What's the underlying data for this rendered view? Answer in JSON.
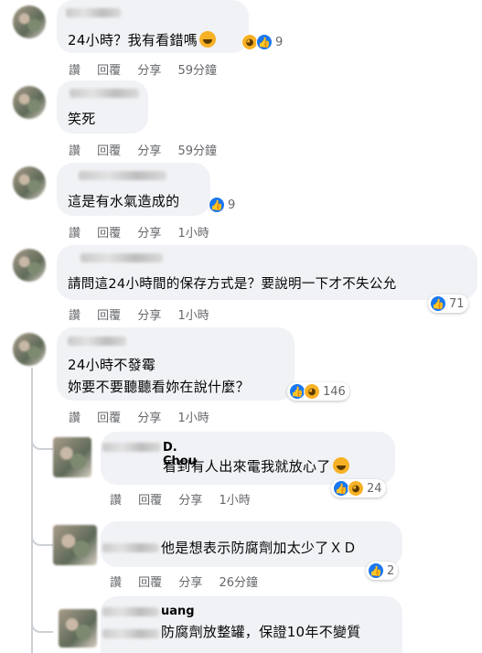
{
  "actions": {
    "like": "讚",
    "reply": "回覆",
    "share": "分享"
  },
  "colors": {
    "bubble": "#f0f2f5",
    "meta": "#65676b",
    "like": "#1877f2",
    "haha": "#f7b125"
  },
  "comments": [
    {
      "text": "24小時？我有看錯嗎",
      "time": "59分鐘",
      "reaction_count": "9",
      "reactions": [
        "haha-icon",
        "like-icon"
      ],
      "inline_emoji": "grinning-emoji"
    },
    {
      "text": "笑死",
      "time": "59分鐘"
    },
    {
      "text": "這是有水氣造成的",
      "time": "1小時",
      "reaction_count": "9",
      "reactions": [
        "like-icon"
      ]
    },
    {
      "text": "請問這24小時間的保存方式是？要說明一下才不失公允",
      "time": "1小時",
      "reaction_count": "71",
      "reactions": [
        "like-icon"
      ]
    },
    {
      "line1": "24小時不發霉",
      "line2": "妳要不要聽聽看妳在說什麼？",
      "time": "1小時",
      "reaction_count": "146",
      "reactions": [
        "like-icon",
        "haha-icon"
      ]
    }
  ],
  "replies": [
    {
      "name": "D. Chou",
      "text": "看到有人出來電我就放心了",
      "time": "1小時",
      "reaction_count": "24",
      "reactions": [
        "like-icon",
        "haha-icon"
      ],
      "inline_emoji": "upside-down-emoji"
    },
    {
      "text": "他是想表示防腐劑加太少了ＸＤ",
      "time": "26分鐘",
      "reaction_count": "2",
      "reactions": [
        "like-icon"
      ]
    },
    {
      "name": "uang",
      "text": "防腐劑放整罐，保證10年不變質"
    }
  ]
}
